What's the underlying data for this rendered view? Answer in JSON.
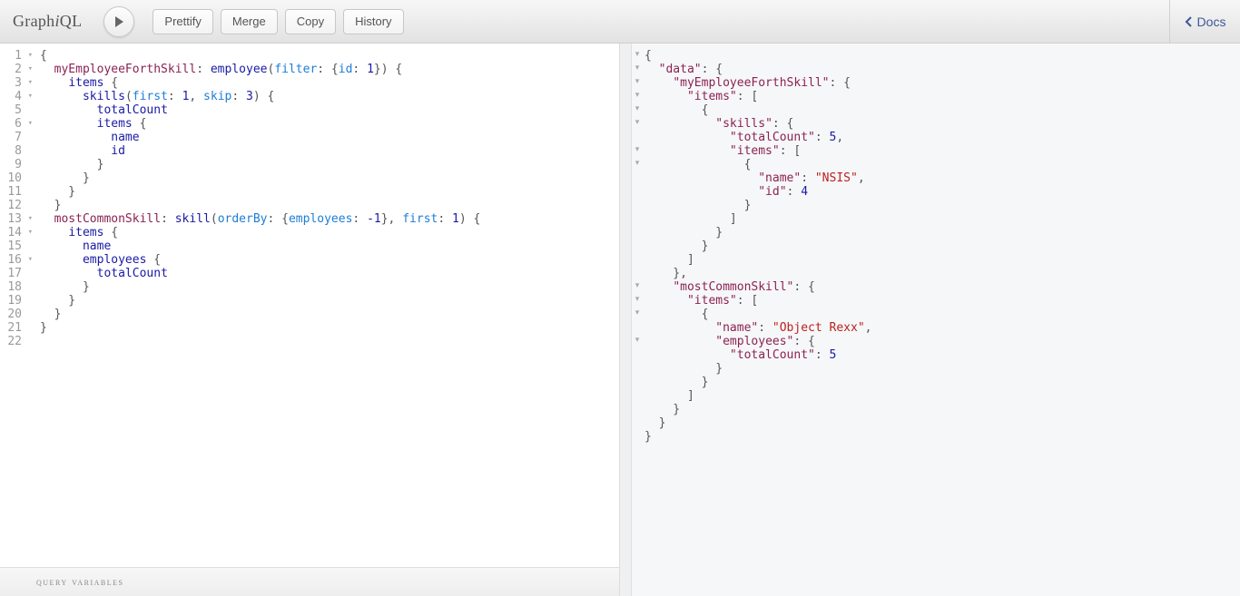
{
  "app": {
    "logo_prefix": "Graph",
    "logo_em": "i",
    "logo_suffix": "QL"
  },
  "toolbar": {
    "prettify": "Prettify",
    "merge": "Merge",
    "copy": "Copy",
    "history": "History",
    "docs": "Docs"
  },
  "query_lines": [
    {
      "n": 1,
      "fold": true,
      "tokens": [
        {
          "t": "{",
          "c": "cm-punct"
        }
      ]
    },
    {
      "n": 2,
      "fold": true,
      "tokens": [
        {
          "t": "  "
        },
        {
          "t": "myEmployeeForthSkill",
          "c": "cm-attr"
        },
        {
          "t": ": "
        },
        {
          "t": "employee",
          "c": "cm-def"
        },
        {
          "t": "("
        },
        {
          "t": "filter",
          "c": "cm-alias"
        },
        {
          "t": ": {"
        },
        {
          "t": "id",
          "c": "cm-alias"
        },
        {
          "t": ": "
        },
        {
          "t": "1",
          "c": "cm-num"
        },
        {
          "t": "}) {",
          "c": "cm-punct"
        }
      ]
    },
    {
      "n": 3,
      "fold": true,
      "tokens": [
        {
          "t": "    "
        },
        {
          "t": "items",
          "c": "cm-prop"
        },
        {
          "t": " {",
          "c": "cm-punct"
        }
      ]
    },
    {
      "n": 4,
      "fold": true,
      "tokens": [
        {
          "t": "      "
        },
        {
          "t": "skills",
          "c": "cm-prop"
        },
        {
          "t": "("
        },
        {
          "t": "first",
          "c": "cm-alias"
        },
        {
          "t": ": "
        },
        {
          "t": "1",
          "c": "cm-num"
        },
        {
          "t": ", "
        },
        {
          "t": "skip",
          "c": "cm-alias"
        },
        {
          "t": ": "
        },
        {
          "t": "3",
          "c": "cm-num"
        },
        {
          "t": ") {",
          "c": "cm-punct"
        }
      ]
    },
    {
      "n": 5,
      "fold": false,
      "tokens": [
        {
          "t": "        "
        },
        {
          "t": "totalCount",
          "c": "cm-prop"
        }
      ]
    },
    {
      "n": 6,
      "fold": true,
      "tokens": [
        {
          "t": "        "
        },
        {
          "t": "items",
          "c": "cm-prop"
        },
        {
          "t": " {",
          "c": "cm-punct"
        }
      ]
    },
    {
      "n": 7,
      "fold": false,
      "tokens": [
        {
          "t": "          "
        },
        {
          "t": "name",
          "c": "cm-prop"
        }
      ]
    },
    {
      "n": 8,
      "fold": false,
      "tokens": [
        {
          "t": "          "
        },
        {
          "t": "id",
          "c": "cm-prop"
        }
      ]
    },
    {
      "n": 9,
      "fold": false,
      "tokens": [
        {
          "t": "        }",
          "c": "cm-punct"
        }
      ]
    },
    {
      "n": 10,
      "fold": false,
      "tokens": [
        {
          "t": "      }",
          "c": "cm-punct"
        }
      ]
    },
    {
      "n": 11,
      "fold": false,
      "tokens": [
        {
          "t": "    }",
          "c": "cm-punct"
        }
      ]
    },
    {
      "n": 12,
      "fold": false,
      "tokens": [
        {
          "t": "  }",
          "c": "cm-punct"
        }
      ]
    },
    {
      "n": 13,
      "fold": true,
      "tokens": [
        {
          "t": "  "
        },
        {
          "t": "mostCommonSkill",
          "c": "cm-attr"
        },
        {
          "t": ": "
        },
        {
          "t": "skill",
          "c": "cm-def"
        },
        {
          "t": "("
        },
        {
          "t": "orderBy",
          "c": "cm-alias"
        },
        {
          "t": ": {"
        },
        {
          "t": "employees",
          "c": "cm-alias"
        },
        {
          "t": ": "
        },
        {
          "t": "-1",
          "c": "cm-num"
        },
        {
          "t": "}, "
        },
        {
          "t": "first",
          "c": "cm-alias"
        },
        {
          "t": ": "
        },
        {
          "t": "1",
          "c": "cm-num"
        },
        {
          "t": ") {",
          "c": "cm-punct"
        }
      ]
    },
    {
      "n": 14,
      "fold": true,
      "tokens": [
        {
          "t": "    "
        },
        {
          "t": "items",
          "c": "cm-prop"
        },
        {
          "t": " {",
          "c": "cm-punct"
        }
      ]
    },
    {
      "n": 15,
      "fold": false,
      "tokens": [
        {
          "t": "      "
        },
        {
          "t": "name",
          "c": "cm-prop"
        }
      ]
    },
    {
      "n": 16,
      "fold": true,
      "tokens": [
        {
          "t": "      "
        },
        {
          "t": "employees",
          "c": "cm-prop"
        },
        {
          "t": " {",
          "c": "cm-punct"
        }
      ]
    },
    {
      "n": 17,
      "fold": false,
      "tokens": [
        {
          "t": "        "
        },
        {
          "t": "totalCount",
          "c": "cm-prop"
        }
      ]
    },
    {
      "n": 18,
      "fold": false,
      "tokens": [
        {
          "t": "      }",
          "c": "cm-punct"
        }
      ]
    },
    {
      "n": 19,
      "fold": false,
      "tokens": [
        {
          "t": "    }",
          "c": "cm-punct"
        }
      ]
    },
    {
      "n": 20,
      "fold": false,
      "tokens": [
        {
          "t": "  }",
          "c": "cm-punct"
        }
      ]
    },
    {
      "n": 21,
      "fold": false,
      "tokens": [
        {
          "t": "}",
          "c": "cm-punct"
        }
      ]
    },
    {
      "n": 22,
      "fold": false,
      "tokens": [
        {
          "t": ""
        }
      ]
    }
  ],
  "result_lines": [
    {
      "fold": true,
      "segs": [
        {
          "t": "{",
          "c": "rp"
        }
      ]
    },
    {
      "fold": true,
      "segs": [
        {
          "t": "  "
        },
        {
          "t": "\"data\"",
          "c": "rk"
        },
        {
          "t": ": {",
          "c": "rp"
        }
      ]
    },
    {
      "fold": true,
      "segs": [
        {
          "t": "    "
        },
        {
          "t": "\"myEmployeeForthSkill\"",
          "c": "rk"
        },
        {
          "t": ": {",
          "c": "rp"
        }
      ]
    },
    {
      "fold": true,
      "segs": [
        {
          "t": "      "
        },
        {
          "t": "\"items\"",
          "c": "rk"
        },
        {
          "t": ": [",
          "c": "rp"
        }
      ]
    },
    {
      "fold": true,
      "segs": [
        {
          "t": "        {",
          "c": "rp"
        }
      ]
    },
    {
      "fold": true,
      "segs": [
        {
          "t": "          "
        },
        {
          "t": "\"skills\"",
          "c": "rk"
        },
        {
          "t": ": {",
          "c": "rp"
        }
      ]
    },
    {
      "fold": false,
      "segs": [
        {
          "t": "            "
        },
        {
          "t": "\"totalCount\"",
          "c": "rk"
        },
        {
          "t": ": ",
          "c": "rp"
        },
        {
          "t": "5",
          "c": "rn"
        },
        {
          "t": ",",
          "c": "rp"
        }
      ]
    },
    {
      "fold": true,
      "segs": [
        {
          "t": "            "
        },
        {
          "t": "\"items\"",
          "c": "rk"
        },
        {
          "t": ": [",
          "c": "rp"
        }
      ]
    },
    {
      "fold": true,
      "segs": [
        {
          "t": "              {",
          "c": "rp"
        }
      ]
    },
    {
      "fold": false,
      "segs": [
        {
          "t": "                "
        },
        {
          "t": "\"name\"",
          "c": "rk"
        },
        {
          "t": ": ",
          "c": "rp"
        },
        {
          "t": "\"NSIS\"",
          "c": "rs"
        },
        {
          "t": ",",
          "c": "rp"
        }
      ]
    },
    {
      "fold": false,
      "segs": [
        {
          "t": "                "
        },
        {
          "t": "\"id\"",
          "c": "rk"
        },
        {
          "t": ": ",
          "c": "rp"
        },
        {
          "t": "4",
          "c": "rn"
        }
      ]
    },
    {
      "fold": false,
      "segs": [
        {
          "t": "              }",
          "c": "rp"
        }
      ]
    },
    {
      "fold": false,
      "segs": [
        {
          "t": "            ]",
          "c": "rp"
        }
      ]
    },
    {
      "fold": false,
      "segs": [
        {
          "t": "          }",
          "c": "rp"
        }
      ]
    },
    {
      "fold": false,
      "segs": [
        {
          "t": "        }",
          "c": "rp"
        }
      ]
    },
    {
      "fold": false,
      "segs": [
        {
          "t": "      ]",
          "c": "rp"
        }
      ]
    },
    {
      "fold": false,
      "segs": [
        {
          "t": "    },",
          "c": "rp"
        }
      ]
    },
    {
      "fold": true,
      "segs": [
        {
          "t": "    "
        },
        {
          "t": "\"mostCommonSkill\"",
          "c": "rk"
        },
        {
          "t": ": {",
          "c": "rp"
        }
      ]
    },
    {
      "fold": true,
      "segs": [
        {
          "t": "      "
        },
        {
          "t": "\"items\"",
          "c": "rk"
        },
        {
          "t": ": [",
          "c": "rp"
        }
      ]
    },
    {
      "fold": true,
      "segs": [
        {
          "t": "        {",
          "c": "rp"
        }
      ]
    },
    {
      "fold": false,
      "segs": [
        {
          "t": "          "
        },
        {
          "t": "\"name\"",
          "c": "rk"
        },
        {
          "t": ": ",
          "c": "rp"
        },
        {
          "t": "\"Object Rexx\"",
          "c": "rs"
        },
        {
          "t": ",",
          "c": "rp"
        }
      ]
    },
    {
      "fold": true,
      "segs": [
        {
          "t": "          "
        },
        {
          "t": "\"employees\"",
          "c": "rk"
        },
        {
          "t": ": {",
          "c": "rp"
        }
      ]
    },
    {
      "fold": false,
      "segs": [
        {
          "t": "            "
        },
        {
          "t": "\"totalCount\"",
          "c": "rk"
        },
        {
          "t": ": ",
          "c": "rp"
        },
        {
          "t": "5",
          "c": "rn"
        }
      ]
    },
    {
      "fold": false,
      "segs": [
        {
          "t": "          }",
          "c": "rp"
        }
      ]
    },
    {
      "fold": false,
      "segs": [
        {
          "t": "        }",
          "c": "rp"
        }
      ]
    },
    {
      "fold": false,
      "segs": [
        {
          "t": "      ]",
          "c": "rp"
        }
      ]
    },
    {
      "fold": false,
      "segs": [
        {
          "t": "    }",
          "c": "rp"
        }
      ]
    },
    {
      "fold": false,
      "segs": [
        {
          "t": "  }",
          "c": "rp"
        }
      ]
    },
    {
      "fold": false,
      "segs": [
        {
          "t": "}",
          "c": "rp"
        }
      ]
    }
  ],
  "variables_label": "query variables"
}
